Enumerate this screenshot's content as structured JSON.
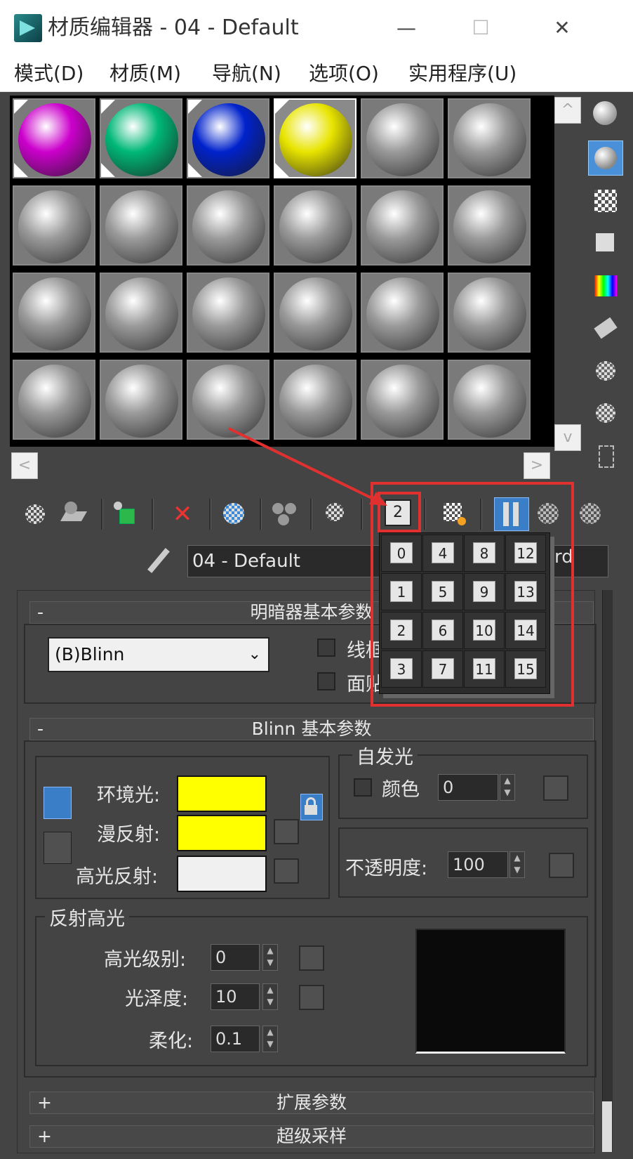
{
  "window": {
    "title": "材质编辑器 - 04 - Default",
    "minimize": "—",
    "maximize": "☐",
    "close": "✕"
  },
  "menu": {
    "items": [
      "模式(D)",
      "材质(M)",
      "导航(N)",
      "选项(O)",
      "实用程序(U)"
    ]
  },
  "slots": {
    "rows": [
      [
        {
          "color": "#cc00cc",
          "used": true,
          "active": false
        },
        {
          "color": "#00b878",
          "used": true,
          "active": false
        },
        {
          "color": "#0022cc",
          "used": true,
          "active": false
        },
        {
          "color": "#e8e400",
          "used": true,
          "active": true
        },
        {
          "color": "#9a9a9a",
          "used": false,
          "active": false
        },
        {
          "color": "#9a9a9a",
          "used": false,
          "active": false
        }
      ],
      [
        {
          "color": "#9a9a9a"
        },
        {
          "color": "#9a9a9a"
        },
        {
          "color": "#9a9a9a"
        },
        {
          "color": "#9a9a9a"
        },
        {
          "color": "#9a9a9a"
        },
        {
          "color": "#9a9a9a"
        }
      ],
      [
        {
          "color": "#9a9a9a"
        },
        {
          "color": "#9a9a9a"
        },
        {
          "color": "#9a9a9a"
        },
        {
          "color": "#9a9a9a"
        },
        {
          "color": "#9a9a9a"
        },
        {
          "color": "#9a9a9a"
        }
      ],
      [
        {
          "color": "#9a9a9a"
        },
        {
          "color": "#9a9a9a"
        },
        {
          "color": "#9a9a9a"
        },
        {
          "color": "#9a9a9a"
        },
        {
          "color": "#9a9a9a"
        },
        {
          "color": "#9a9a9a"
        }
      ]
    ],
    "scroll_up": "^",
    "scroll_down": "v",
    "scroll_left": "<",
    "scroll_right": ">"
  },
  "toolbar": {
    "slot_id_value": "2"
  },
  "name": {
    "value": "04 - Default",
    "type_suffix": "rd"
  },
  "popup": {
    "numbers": [
      [
        "0",
        "4",
        "8",
        "12"
      ],
      [
        "1",
        "5",
        "9",
        "13"
      ],
      [
        "2",
        "6",
        "10",
        "14"
      ],
      [
        "3",
        "7",
        "11",
        "15"
      ]
    ]
  },
  "shader": {
    "rollout_title": "明暗器基本参数",
    "shader_value": "(B)Blinn",
    "wire_label": "线框",
    "face_label": "面贴"
  },
  "blinn": {
    "rollout_title": "Blinn 基本参数",
    "ambient_label": "环境光:",
    "diffuse_label": "漫反射:",
    "specular_label": "高光反射:",
    "ambient_color": "#ffff00",
    "diffuse_color": "#ffff00",
    "specular_color": "#f0f0f0",
    "self_illum_title": "自发光",
    "self_illum_color_label": "颜色",
    "self_illum_value": "0",
    "opacity_label": "不透明度:",
    "opacity_value": "100",
    "spec_group_title": "反射高光",
    "spec_level_label": "高光级别:",
    "spec_level_value": "0",
    "gloss_label": "光泽度:",
    "gloss_value": "10",
    "soften_label": "柔化:",
    "soften_value": "0.1"
  },
  "rollouts": {
    "extended": "扩展参数",
    "supersampling": "超级采样",
    "plus": "+",
    "minus": "-"
  }
}
